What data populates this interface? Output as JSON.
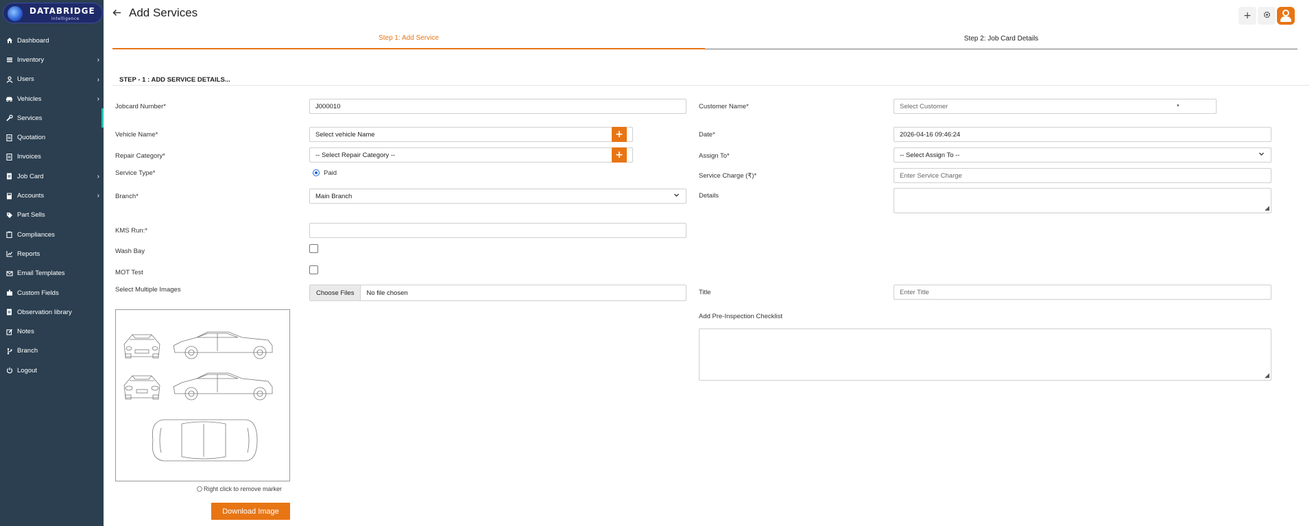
{
  "brand": {
    "name": "DATABRIDGE",
    "tagline": "intelligence"
  },
  "sidebar": {
    "items": [
      {
        "label": "Dashboard",
        "icon": "home-icon",
        "has_submenu": false
      },
      {
        "label": "Inventory",
        "icon": "inventory-icon",
        "has_submenu": true
      },
      {
        "label": "Users",
        "icon": "user-icon",
        "has_submenu": true
      },
      {
        "label": "Vehicles",
        "icon": "car-icon",
        "has_submenu": true
      },
      {
        "label": "Services",
        "icon": "wrench-icon",
        "has_submenu": false,
        "active": true
      },
      {
        "label": "Quotation",
        "icon": "document-icon",
        "has_submenu": false
      },
      {
        "label": "Invoices",
        "icon": "document-icon",
        "has_submenu": false
      },
      {
        "label": "Job Card",
        "icon": "document-icon",
        "has_submenu": true
      },
      {
        "label": "Accounts",
        "icon": "calculator-icon",
        "has_submenu": true
      },
      {
        "label": "Part Sells",
        "icon": "tag-icon",
        "has_submenu": false
      },
      {
        "label": "Compliances",
        "icon": "clipboard-icon",
        "has_submenu": false
      },
      {
        "label": "Reports",
        "icon": "chart-line-icon",
        "has_submenu": false
      },
      {
        "label": "Email Templates",
        "icon": "envelope-icon",
        "has_submenu": false
      },
      {
        "label": "Custom Fields",
        "icon": "puzzle-icon",
        "has_submenu": false
      },
      {
        "label": "Observation library",
        "icon": "document-icon",
        "has_submenu": false
      },
      {
        "label": "Notes",
        "icon": "edit-icon",
        "has_submenu": false
      },
      {
        "label": "Branch",
        "icon": "branch-icon",
        "has_submenu": false
      },
      {
        "label": "Logout",
        "icon": "power-icon",
        "has_submenu": false
      }
    ]
  },
  "header": {
    "title": "Add Services"
  },
  "tabs": [
    {
      "label": "Step 1: Add Service",
      "active": true
    },
    {
      "label": "Step 2: Job Card Details",
      "active": false
    }
  ],
  "section": {
    "title": "STEP - 1 : ADD SERVICE DETAILS..."
  },
  "form": {
    "jobcard_number": {
      "label": "Jobcard Number*",
      "value": "J000010"
    },
    "customer_name": {
      "label": "Customer Name*",
      "placeholder": "Select Customer"
    },
    "vehicle_name": {
      "label": "Vehicle Name*",
      "value": "Select vehicle Name"
    },
    "date": {
      "label": "Date*",
      "value": "2026-04-16 09:46:24"
    },
    "repair_category": {
      "label": "Repair Category*",
      "value": "-- Select Repair Category --"
    },
    "assign_to": {
      "label": "Assign To*",
      "value": "-- Select Assign To --"
    },
    "service_type": {
      "label": "Service Type*",
      "option": "Paid"
    },
    "service_charge": {
      "label": "Service Charge (₹)*",
      "placeholder": "Enter Service Charge"
    },
    "branch": {
      "label": "Branch*",
      "value": "Main Branch"
    },
    "details": {
      "label": "Details"
    },
    "kms_run": {
      "label": "KMS Run:*",
      "value": ""
    },
    "wash_bay": {
      "label": "Wash Bay"
    },
    "mot_test": {
      "label": "MOT Test"
    },
    "images": {
      "label": "Select Multiple Images",
      "button": "Choose Files",
      "status": "No file chosen"
    },
    "title": {
      "label": "Title",
      "placeholder": "Enter Title"
    },
    "checklist": {
      "label": "Add Pre-Inspection Checklist"
    }
  },
  "diagram": {
    "hint": "Right click to remove marker",
    "download_label": "Download Image"
  },
  "colors": {
    "accent": "#e87514",
    "sidebar_bg": "#2b3f50",
    "active_indicator": "#27c2b1",
    "radio": "#1e66d6"
  }
}
